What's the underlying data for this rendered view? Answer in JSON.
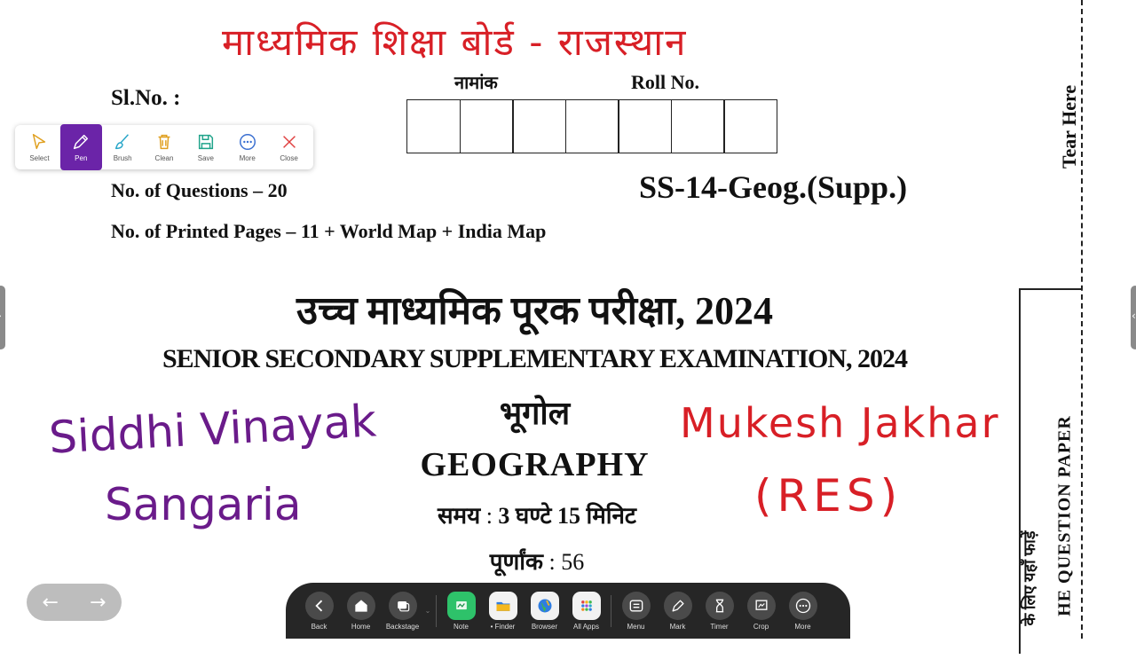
{
  "handwritten": {
    "header_hindi": "माध्यमिक शिक्षा बोर्ड - राजस्थान",
    "left_line1": "Siddhi Vinayak",
    "left_line2": "Sangaria",
    "right_line1": "Mukesh Jakhar",
    "right_line2": "(RES)"
  },
  "paper": {
    "sl_no_label": "Sl.No. :",
    "roll_label_hindi": "नामांक",
    "roll_label": "Roll No.",
    "roll_box_count": 7,
    "questions": "No. of Questions – 20",
    "code": "SS-14-Geog.(Supp.)",
    "pages": "No. of Printed Pages – 11 + World Map + India Map",
    "exam_hindi": "उच्च माध्यमिक पूरक परीक्षा, 2024",
    "exam_english": "SENIOR SECONDARY SUPPLEMENTARY EXAMINATION, 2024",
    "subject_hindi": "भूगोल",
    "subject_english": "GEOGRAPHY",
    "time_label": "समय",
    "time_value": "3 घण्टे 15 मिनिट",
    "marks_label": "पूर्णांक",
    "marks_value": "56",
    "tear_here": "Tear Here",
    "side_question_paper": "HE QUESTION PAPER",
    "side_hindi": "के लिए यहाँ फाड़ें"
  },
  "toolbar": {
    "items": [
      {
        "label": "Select",
        "icon": "cursor-icon"
      },
      {
        "label": "Pen",
        "icon": "pen-icon",
        "active": true
      },
      {
        "label": "Brush",
        "icon": "brush-icon"
      },
      {
        "label": "Clean",
        "icon": "trash-icon"
      },
      {
        "label": "Save",
        "icon": "save-icon"
      },
      {
        "label": "More",
        "icon": "more-icon"
      },
      {
        "label": "Close",
        "icon": "close-icon"
      }
    ],
    "accent": "#6b24a8"
  },
  "nav": {
    "back_arrow": "←",
    "forward_arrow": "→"
  },
  "dock": {
    "items": [
      {
        "label": "Back",
        "icon": "chevron-left-icon"
      },
      {
        "label": "Home",
        "icon": "home-icon"
      },
      {
        "label": "Backstage",
        "icon": "windows-icon"
      },
      {
        "label": "Note",
        "icon": "note-app-icon"
      },
      {
        "label": "• Finder",
        "icon": "folder-icon"
      },
      {
        "label": "Browser",
        "icon": "browser-icon"
      },
      {
        "label": "All Apps",
        "icon": "grid-icon"
      },
      {
        "label": "Menu",
        "icon": "menu-icon"
      },
      {
        "label": "Mark",
        "icon": "marker-icon"
      },
      {
        "label": "Timer",
        "icon": "hourglass-icon"
      },
      {
        "label": "Crop",
        "icon": "crop-icon"
      },
      {
        "label": "More",
        "icon": "more-icon"
      }
    ]
  }
}
